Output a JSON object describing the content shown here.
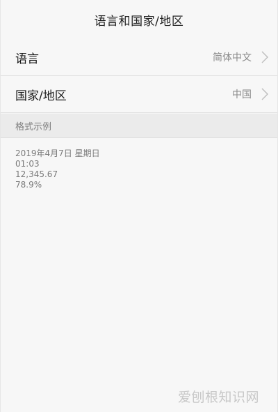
{
  "header": {
    "title": "语言和国家/地区"
  },
  "settings": [
    {
      "label": "语言",
      "value": "简体中文"
    },
    {
      "label": "国家/地区",
      "value": "中国"
    }
  ],
  "format_section": {
    "header": "格式示例",
    "examples": [
      "2019年4月7日 星期日",
      "01:03",
      "12,345.67",
      "78.9%"
    ]
  },
  "watermark": "爱刨根知识网",
  "icons": {
    "row_arrow": "chevron-right-icon"
  }
}
